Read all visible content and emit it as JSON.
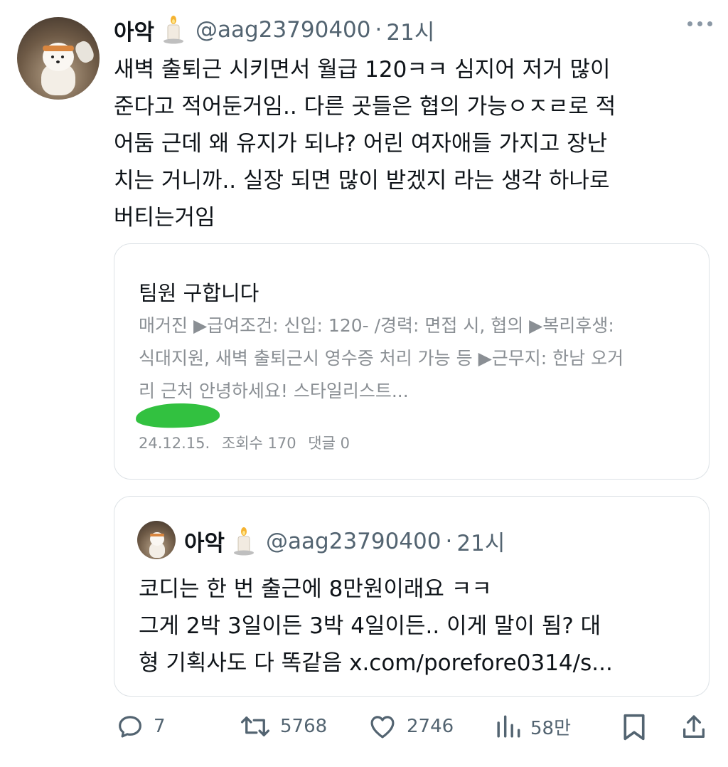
{
  "author": {
    "name": "아악",
    "handle": "@aag23790400",
    "separator": "·",
    "time": "21시"
  },
  "tweet": {
    "lines": [
      "새벽 출퇴근 시키면서 월급 120ㅋㅋ 심지어 저거 많이",
      "준다고 적어둔거임.. 다른 곳들은 협의 가능ㅇㅈㄹ로 적",
      "어둠 근데 왜 유지가 되냐? 어린 여자애들 가지고 장난",
      "치는 거니까.. 실장 되면 많이 받겠지 라는 생각 하나로",
      "버티는거임"
    ]
  },
  "card": {
    "title": "팀원 구합니다",
    "lines": [
      "매거진 ▶급여조건: 신입: 120- /경력: 면접 시, 협의 ▶복리후생:",
      "식대지원, 새벽 출퇴근시 영수증 처리 가능 등 ▶근무지: 한남 오거",
      "리 근처 안녕하세요! 스타일리스트..."
    ],
    "date": "24.12.15.",
    "views_label": "조회수 170",
    "comments_label": "댓글 0"
  },
  "quote": {
    "name": "아악",
    "handle": "@aag23790400",
    "separator": "·",
    "time": "21시",
    "lines": [
      "코디는 한 번 출근에 8만원이래요 ㅋㅋ",
      "그게 2박 3일이든 3박 4일이든.. 이게 말이 됨? 대",
      "형 기획사도 다 똑같음 x.com/porefore0314/s..."
    ]
  },
  "actions": {
    "replies": "7",
    "retweets": "5768",
    "likes": "2746",
    "views": "58만"
  },
  "icons": {
    "more": "more-horizontal-icon",
    "candle": "candle-emoji-icon",
    "reply": "reply-icon",
    "retweet": "retweet-icon",
    "like": "heart-icon",
    "views": "analytics-icon",
    "bookmark": "bookmark-icon",
    "share": "share-icon"
  },
  "colors": {
    "text": "#0f1419",
    "secondary": "#536471",
    "card_muted": "#8a8f94",
    "border": "#dde2e6",
    "redaction_green": "#32c140"
  }
}
